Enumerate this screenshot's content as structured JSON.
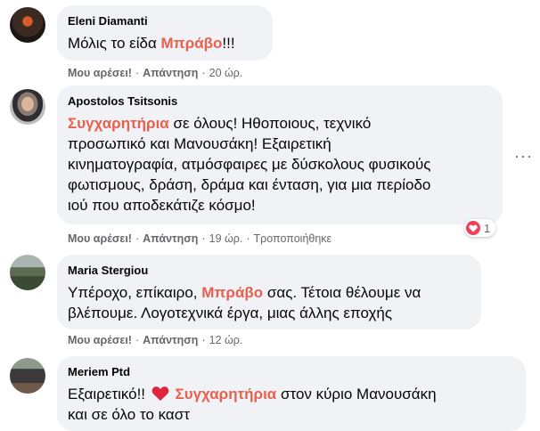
{
  "comments": [
    {
      "author": "Eleni Diamanti",
      "text_parts": [
        "Μόλις το είδα ",
        "Μπράβο",
        "!!!"
      ],
      "like": "Μου αρέσει!",
      "reply": "Απάντηση",
      "time": "20 ώρ."
    },
    {
      "author": "Apostolos Tsitsonis",
      "text_lines": [
        [
          "Συγχαρητήρια",
          " σε όλους! Ηθοποιους, τεχνικό"
        ],
        [
          "",
          "προσωπικό και Μανουσάκη! Εξαιρετική"
        ],
        [
          "",
          "κινηματογραφία, ατμόσφαιρες με δύσκολους φυσικούς"
        ],
        [
          "",
          "φωτισμους, δράση, δράμα και ένταση, για μια περίοδο"
        ],
        [
          "",
          "ιού που αποδεκάτιζε κόσμο!"
        ]
      ],
      "like": "Μου αρέσει!",
      "reply": "Απάντηση",
      "time": "19 ώρ.",
      "edited": "Τροποποιήθηκε",
      "reaction_count": "1",
      "more": "···"
    },
    {
      "author": "Maria Stergiou",
      "text_lines": [
        [
          "Υπέροχο, επίκαιρο, ",
          "Μπράβο",
          " σας. Τέτοια θέλουμε να"
        ],
        [
          "βλέπουμε. Λογοτεχνικά έργα, μιας άλλης εποχής",
          "",
          ""
        ]
      ],
      "like": "Μου αρέσει!",
      "reply": "Απάντηση",
      "time": "12 ώρ."
    },
    {
      "author": "Meriem Ptd",
      "text_lines": [
        [
          "Εξαιρετικό!! ",
          "Συγχαρητήρια",
          " στον κύριο Μανουσάκη"
        ],
        [
          "και σε όλο το καστ",
          "",
          ""
        ]
      ]
    }
  ],
  "colors": {
    "highlight": "#e9604f",
    "bubble": "#f0f2f5",
    "meta": "#65676b",
    "heart": "#f33e58"
  }
}
